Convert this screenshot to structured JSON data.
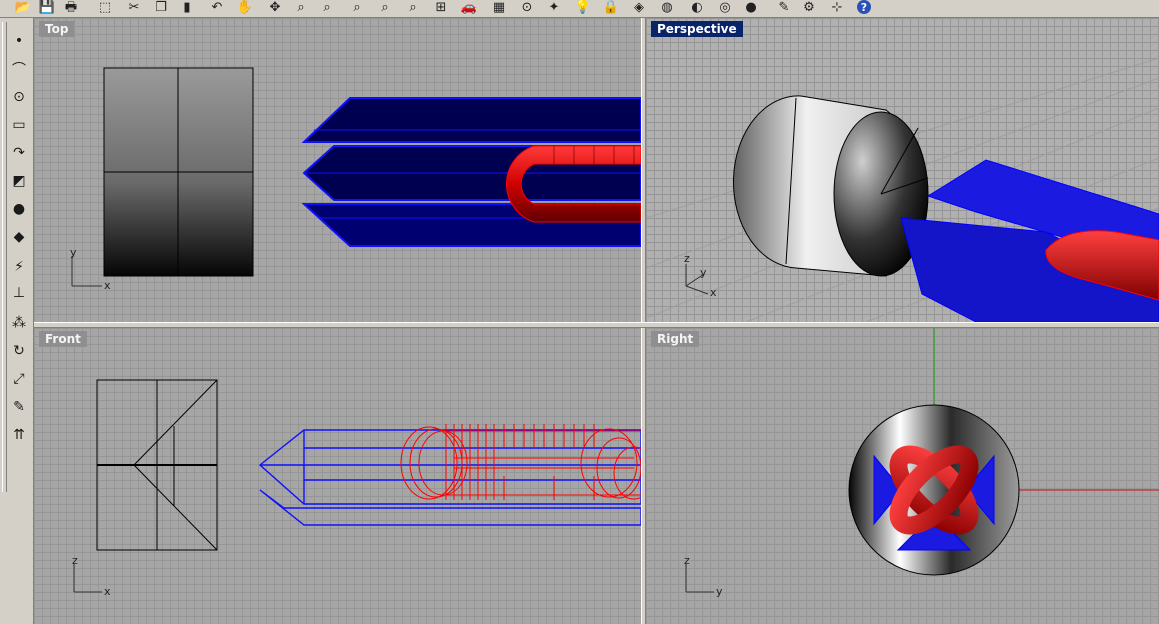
{
  "toolbar": {
    "icons": [
      "open-file-icon",
      "save-icon",
      "print-icon",
      "export-icon",
      "cut-icon",
      "copy-icon",
      "paste-icon",
      "undo-icon",
      "pan-icon",
      "rotate-view-icon",
      "zoom-icon",
      "zoom-window-icon",
      "zoom-extents-icon",
      "zoom-selected-icon",
      "zoom-all-icon",
      "four-viewports-icon",
      "car-icon",
      "grid-icon",
      "point-icon",
      "select-icon",
      "lightbulb-icon",
      "lock-icon",
      "layer-icon",
      "color-icon",
      "sphere-icon",
      "render-icon",
      "pencil-icon",
      "gear-icon",
      "snap-icon",
      "help-icon"
    ]
  },
  "sidebar": {
    "icons": [
      "point-tool-icon",
      "curve-tool-icon",
      "circle-tool-icon",
      "rectangle-tool-icon",
      "arc-tool-icon",
      "surface-tool-icon",
      "solid-tool-icon",
      "mesh-tool-icon",
      "lightning-tool-icon",
      "dimension-tool-icon",
      "transform-tool-icon",
      "rotate-tool-icon",
      "scale-tool-icon",
      "edit-tool-icon",
      "array-tool-icon"
    ]
  },
  "viewports": {
    "top": {
      "label": "Top",
      "axis_v": "y",
      "axis_h": "x"
    },
    "perspective": {
      "label": "Perspective",
      "axis_v": "z",
      "axis_d": "y",
      "axis_h": "x"
    },
    "front": {
      "label": "Front",
      "axis_v": "z",
      "axis_h": "x"
    },
    "right": {
      "label": "Right",
      "axis_v": "z",
      "axis_h": "y"
    }
  },
  "colors": {
    "active_label": "#0a246a",
    "wire_blue": "#0000ee",
    "wire_red": "#ff0000"
  }
}
